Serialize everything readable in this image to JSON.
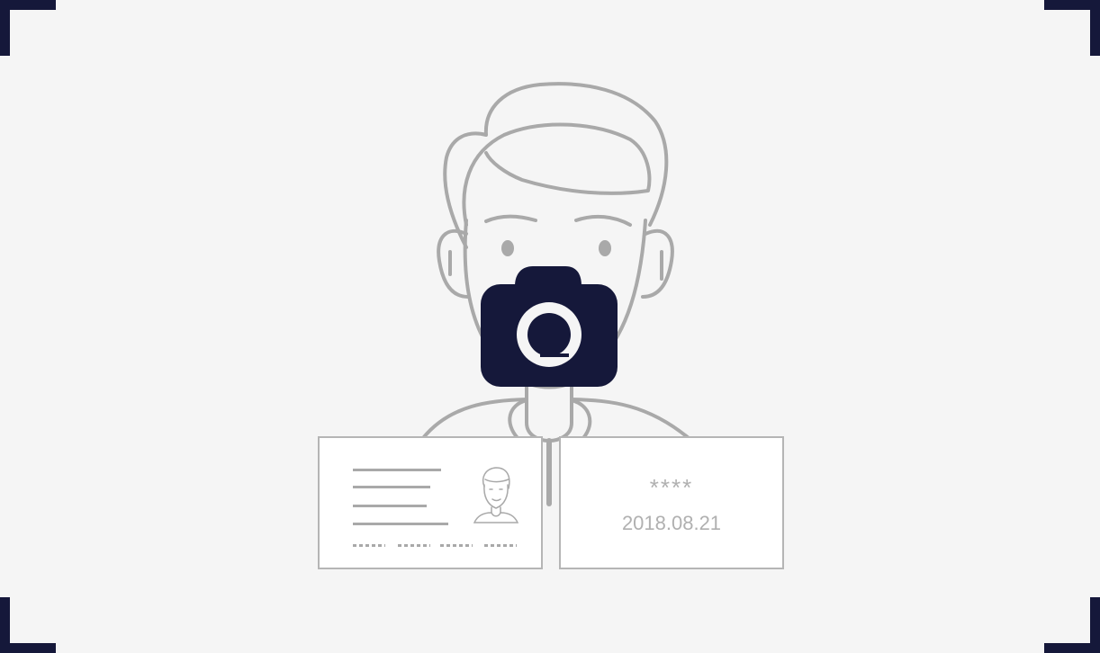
{
  "colors": {
    "frame": "#15183a",
    "camera": "#15183a",
    "outline": "#a9a9a9",
    "card_border": "#b5b5b5",
    "background": "#f5f5f5"
  },
  "camera": {
    "icon": "camera-icon"
  },
  "id_card_back": {
    "masked_number": "****",
    "date": "2018.08.21"
  }
}
